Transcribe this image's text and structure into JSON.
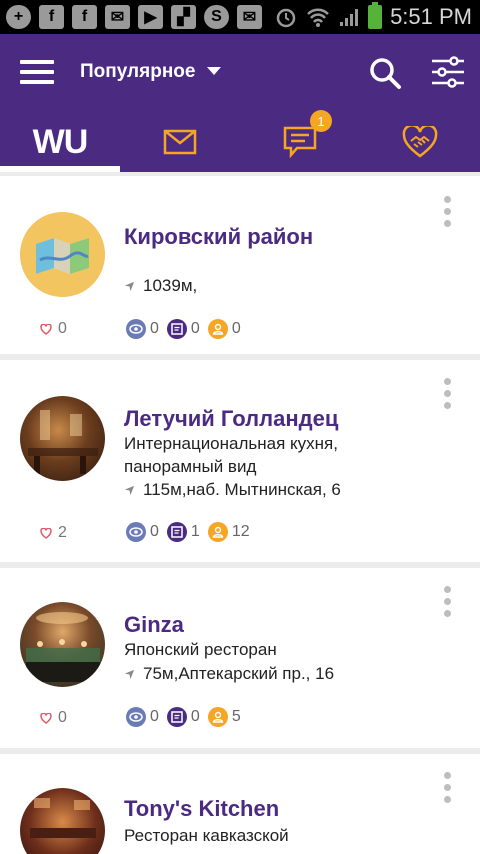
{
  "status_bar": {
    "time": "5:51 PM"
  },
  "app_bar": {
    "title": "Популярное",
    "tabs": [
      {
        "label": "WU",
        "active": true
      },
      {
        "label": "",
        "icon": "mail-icon"
      },
      {
        "label": "",
        "icon": "chat-icon",
        "badge": "1"
      },
      {
        "label": "",
        "icon": "heart-handshake-icon"
      }
    ]
  },
  "colors": {
    "primary": "#4b2a82",
    "accent": "#f5a623",
    "views": "#6b7bb6"
  },
  "places": [
    {
      "name": "Кировский район",
      "desc": "",
      "address": "1039м,",
      "likes": "0",
      "views": "0",
      "comments": "0",
      "visitors": "0",
      "avatar": "map-icon"
    },
    {
      "name": "Летучий Голландец",
      "desc": "Интернациональная кухня, панорамный вид",
      "address": "115м,наб. Мытнинская, 6",
      "likes": "2",
      "views": "0",
      "comments": "1",
      "visitors": "12",
      "avatar": "photo"
    },
    {
      "name": "Ginza",
      "desc": "Японский ресторан",
      "address": "75м,Аптекарский пр., 16",
      "likes": "0",
      "views": "0",
      "comments": "0",
      "visitors": "5",
      "avatar": "photo"
    },
    {
      "name": "Tony's Kitchen",
      "desc": "Ресторан кавказской",
      "address": "",
      "likes": "",
      "views": "",
      "comments": "",
      "visitors": "",
      "avatar": "photo"
    }
  ]
}
